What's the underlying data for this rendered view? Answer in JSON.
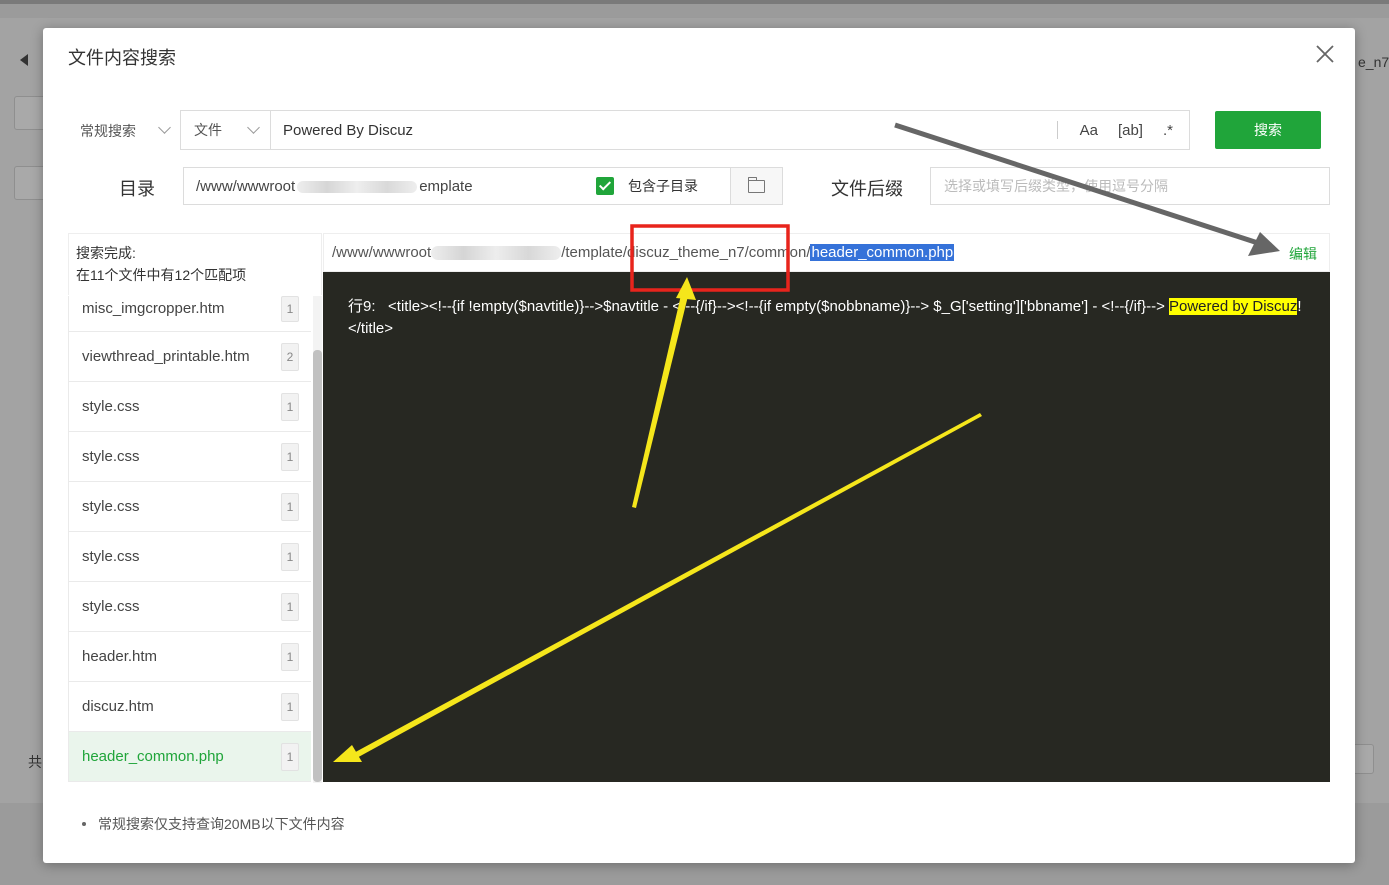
{
  "background": {
    "tab_fragment": "e_n7",
    "footer_fragment": "共"
  },
  "modal": {
    "title": "文件内容搜索",
    "close_icon": "close-icon"
  },
  "search": {
    "mode_label": "常规搜索",
    "type_select": "文件",
    "query": "Powered By Discuz",
    "opt_case": "Aa",
    "opt_word": "[ab]",
    "opt_regex": ".*",
    "button": "搜索"
  },
  "directory": {
    "label": "目录",
    "path_start": "/www/wwwroot",
    "path_end": "emplate",
    "include_subdirs_label": "包含子目录",
    "include_subdirs_checked": true,
    "folder_icon": "folder-icon"
  },
  "suffix": {
    "label": "文件后缀",
    "placeholder": "选择或填写后缀类型，使用逗号分隔"
  },
  "results": {
    "status_line1": "搜索完成:",
    "status_line2": "在11个文件中有12个匹配项",
    "files": [
      {
        "name": "misc_imgcropper.htm",
        "count": "1"
      },
      {
        "name": "viewthread_printable.htm",
        "count": "2"
      },
      {
        "name": "style.css",
        "count": "1"
      },
      {
        "name": "style.css",
        "count": "1"
      },
      {
        "name": "style.css",
        "count": "1"
      },
      {
        "name": "style.css",
        "count": "1"
      },
      {
        "name": "style.css",
        "count": "1"
      },
      {
        "name": "header.htm",
        "count": "1"
      },
      {
        "name": "discuz.htm",
        "count": "1"
      },
      {
        "name": "header_common.php",
        "count": "1"
      }
    ],
    "path_prefix": "/www/wwwroot",
    "path_mid": "/template/discuz_theme_n7/common/",
    "path_file": "header_common.php",
    "edit_label": "编辑",
    "code_line_label": "行9:",
    "code_before": "<title><!--{if !empty($navtitle)}-->$navtitle - <!--{/if}--><!--{if empty($nobbname)}--> $_G['setting']['bbname'] - <!--{/if}--> ",
    "code_match": "Powered by Discuz",
    "code_after": "!</title>"
  },
  "note": "常规搜索仅支持查询20MB以下文件内容",
  "colors": {
    "accent": "#20a53a",
    "path_highlight": "#3572d9",
    "match_highlight": "#ffff00",
    "code_bg": "#272822",
    "annotation_box": "#e8241c",
    "annotation_arrow_yellow": "#f5e61b",
    "annotation_arrow_gray": "#666666"
  }
}
